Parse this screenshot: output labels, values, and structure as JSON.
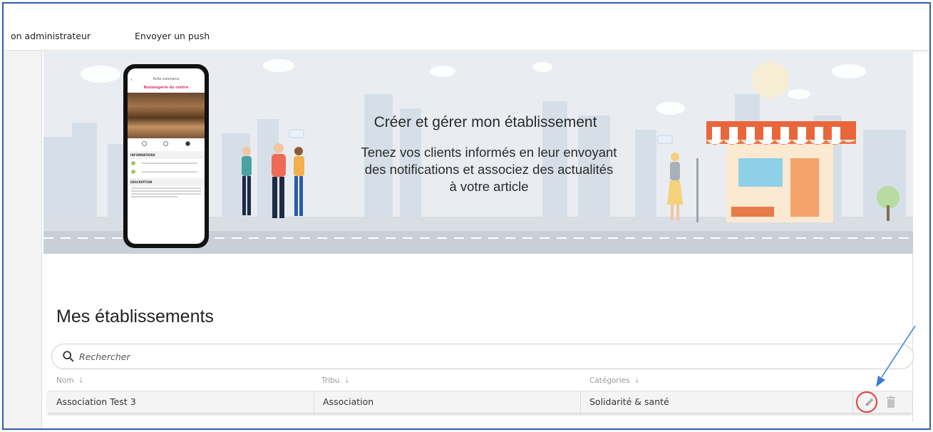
{
  "nav": {
    "items": [
      {
        "label": "on administrateur"
      },
      {
        "label": "Envoyer un push"
      }
    ]
  },
  "banner": {
    "title": "Créer et gérer mon établissement",
    "subtitle_lines": [
      "Tenez vos clients informés en leur envoyant",
      "des notifications et associez des actualités",
      "à votre article"
    ],
    "phone": {
      "header": "Fiche commerce",
      "shop_name": "Boulangerie du centre",
      "section_info": "INFORMATIONS",
      "section_desc": "DESCRIPTION"
    }
  },
  "section": {
    "title": "Mes établissements"
  },
  "search": {
    "placeholder": "Rechercher"
  },
  "table": {
    "columns": [
      "Nom",
      "Tribu",
      "Catégories"
    ],
    "rows": [
      {
        "nom": "Association Test 3",
        "tribu": "Association",
        "categories": "Solidarité & santé"
      }
    ]
  },
  "colors": {
    "frame_border": "#2d5fa6",
    "annotation_arrow": "#3a7bd5",
    "annotation_circle": "#e53935",
    "brand_pink": "#e0356c",
    "awning_orange": "#f07840"
  },
  "icons": {
    "search": "search-icon",
    "edit": "pencil-icon",
    "delete": "trash-icon",
    "sort": "arrow-down-icon"
  }
}
